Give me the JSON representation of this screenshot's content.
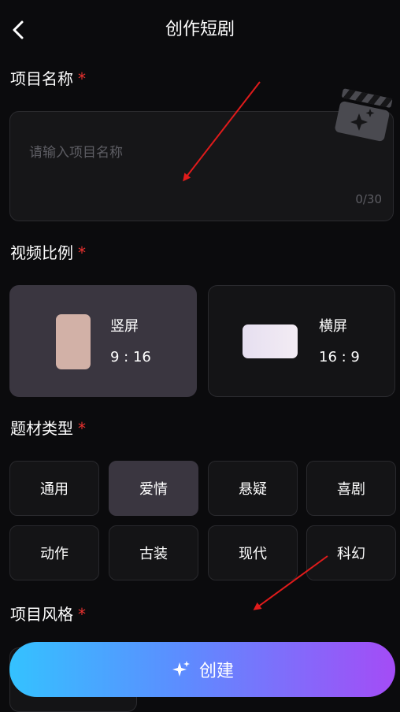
{
  "header": {
    "title": "创作短剧",
    "back_icon": "chevron-left-icon"
  },
  "project_name": {
    "label": "项目名称",
    "required_mark": "*",
    "placeholder": "请输入项目名称",
    "value": "",
    "counter": "0/30",
    "decor_icon": "clapperboard-sparkle-icon"
  },
  "aspect_ratio": {
    "label": "视频比例",
    "required_mark": "*",
    "options": [
      {
        "name": "竖屏",
        "ratio": "9 : 16",
        "selected": true
      },
      {
        "name": "横屏",
        "ratio": "16 : 9",
        "selected": false
      }
    ]
  },
  "genre": {
    "label": "题材类型",
    "required_mark": "*",
    "options": [
      "通用",
      "爱情",
      "悬疑",
      "喜剧",
      "动作",
      "古装",
      "现代",
      "科幻"
    ],
    "selected": "爱情"
  },
  "style": {
    "label": "项目风格",
    "required_mark": "*"
  },
  "create_button": {
    "label": "创建",
    "icon": "sparkle-icon"
  },
  "colors": {
    "background": "#0b0b0d",
    "card": "#141416",
    "selected_card": "#3a3640",
    "required": "#e8312f",
    "annotation_arrow": "#e01b1b",
    "button_gradient_start": "#34c2ff",
    "button_gradient_end": "#a44cf6"
  }
}
